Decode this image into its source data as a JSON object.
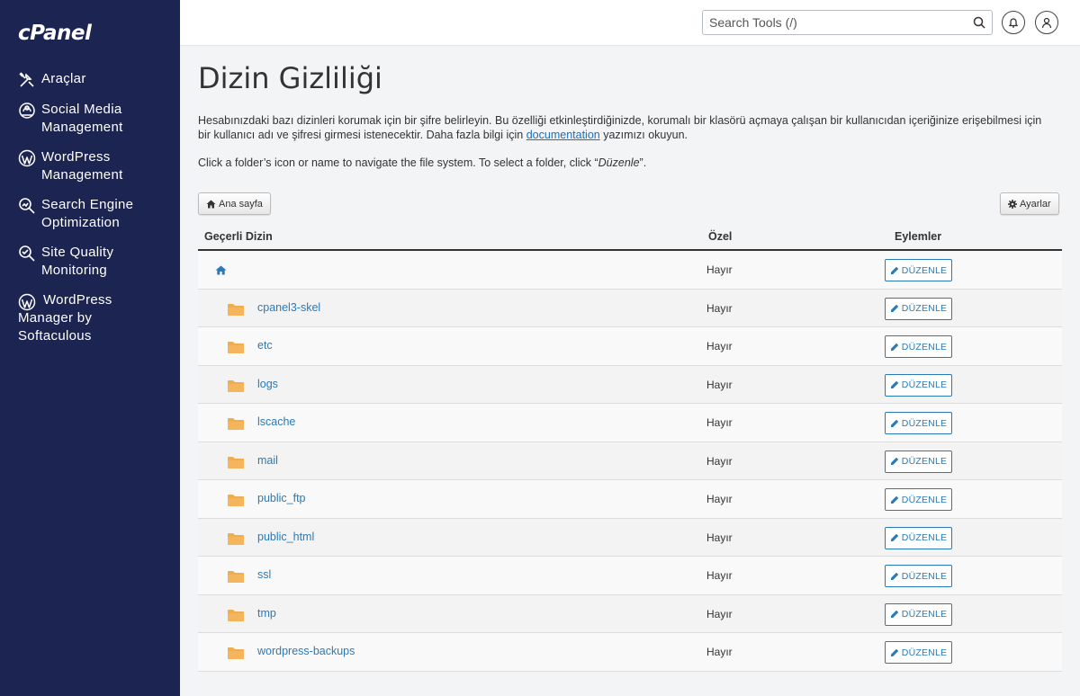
{
  "brand": {
    "logo": "cPanel"
  },
  "sidebar": {
    "items": [
      {
        "label": "Araçlar",
        "icon": "tools-icon"
      },
      {
        "label": "Social Media Management",
        "icon": "social-media-icon"
      },
      {
        "label": "WordPress Management",
        "icon": "wordpress-icon"
      },
      {
        "label": "Search Engine Optimization",
        "icon": "seo-icon"
      },
      {
        "label": "Site Quality Monitoring",
        "icon": "site-quality-icon"
      },
      {
        "label": "WordPress Manager by Softaculous",
        "icon": "wordpress-icon"
      }
    ]
  },
  "topbar": {
    "search_placeholder": "Search Tools (/)"
  },
  "page": {
    "title": "Dizin Gizliliği",
    "desc_before_link": "Hesabınızdaki bazı dizinleri korumak için bir şifre belirleyin. Bu özelliği etkinleştirdiğinizde, korumalı bir klasörü açmaya çalışan bir kullanıcıdan içeriğinize erişebilmesi için bir kullanıcı adı ve şifresi girmesi istenecektir. Daha fazla bilgi için ",
    "desc_link": "documentation",
    "desc_after_link": " yazımızı okuyun.",
    "hint_before": "Click a folder’s icon or name to navigate the file system. To select a folder, click “",
    "hint_em": "Düzenle",
    "hint_after": "”.",
    "home_button": "Ana sayfa",
    "settings_button": "Ayarlar"
  },
  "table": {
    "headers": {
      "dir": "Geçerli Dizin",
      "private": "Özel",
      "actions": "Eylemler"
    },
    "edit_label": "DÜZENLE",
    "rows": [
      {
        "name": "",
        "private": "Hayır",
        "is_home": true
      },
      {
        "name": "cpanel3-skel",
        "private": "Hayır"
      },
      {
        "name": "etc",
        "private": "Hayır"
      },
      {
        "name": "logs",
        "private": "Hayır"
      },
      {
        "name": "lscache",
        "private": "Hayır"
      },
      {
        "name": "mail",
        "private": "Hayır"
      },
      {
        "name": "public_ftp",
        "private": "Hayır"
      },
      {
        "name": "public_html",
        "private": "Hayır"
      },
      {
        "name": "ssl",
        "private": "Hayır"
      },
      {
        "name": "tmp",
        "private": "Hayır"
      },
      {
        "name": "wordpress-backups",
        "private": "Hayır"
      }
    ]
  },
  "colors": {
    "sidebar": "#1c2452",
    "link": "#2a7ab8",
    "folder": "#f0ad4e"
  }
}
